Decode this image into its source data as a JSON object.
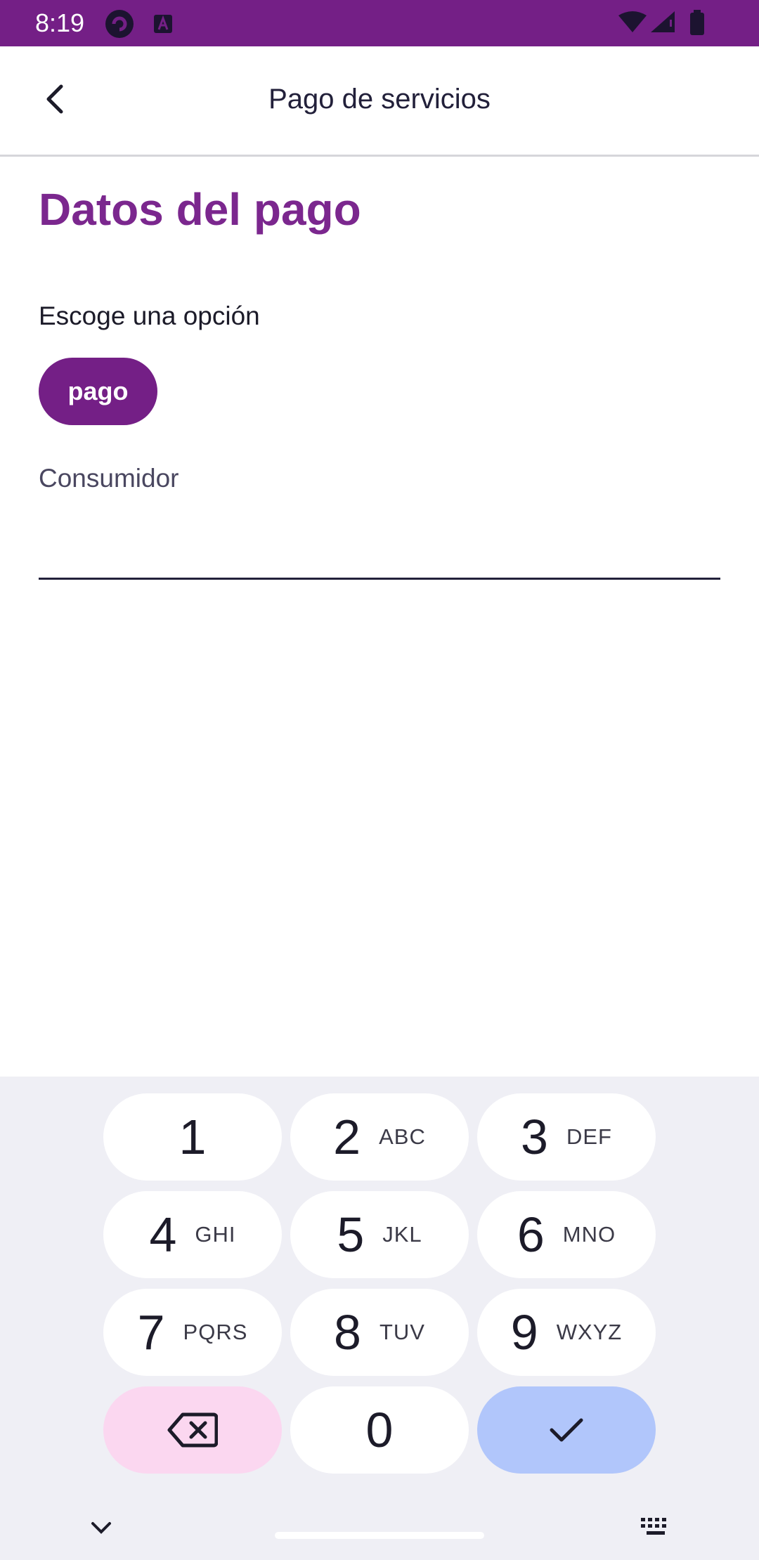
{
  "status_bar": {
    "time": "8:19",
    "background": "#741f86"
  },
  "app_bar": {
    "title": "Pago de servicios"
  },
  "content": {
    "section_title": "Datos del pago",
    "option_prompt": "Escoge una opción",
    "chip_label": "pago",
    "field_label": "Consumidor",
    "field_value": ""
  },
  "keyboard": {
    "keys": [
      {
        "digit": "1",
        "letters": ""
      },
      {
        "digit": "2",
        "letters": "ABC"
      },
      {
        "digit": "3",
        "letters": "DEF"
      },
      {
        "digit": "4",
        "letters": "GHI"
      },
      {
        "digit": "5",
        "letters": "JKL"
      },
      {
        "digit": "6",
        "letters": "MNO"
      },
      {
        "digit": "7",
        "letters": "PQRS"
      },
      {
        "digit": "8",
        "letters": "TUV"
      },
      {
        "digit": "9",
        "letters": "WXYZ"
      },
      {
        "digit": "0",
        "letters": ""
      }
    ],
    "delete_icon": "backspace-icon",
    "done_icon": "checkmark-icon"
  },
  "colors": {
    "accent": "#741f86",
    "title": "#7b278e",
    "delete_key": "#fbd7f0",
    "done_key": "#b1c6fb"
  }
}
